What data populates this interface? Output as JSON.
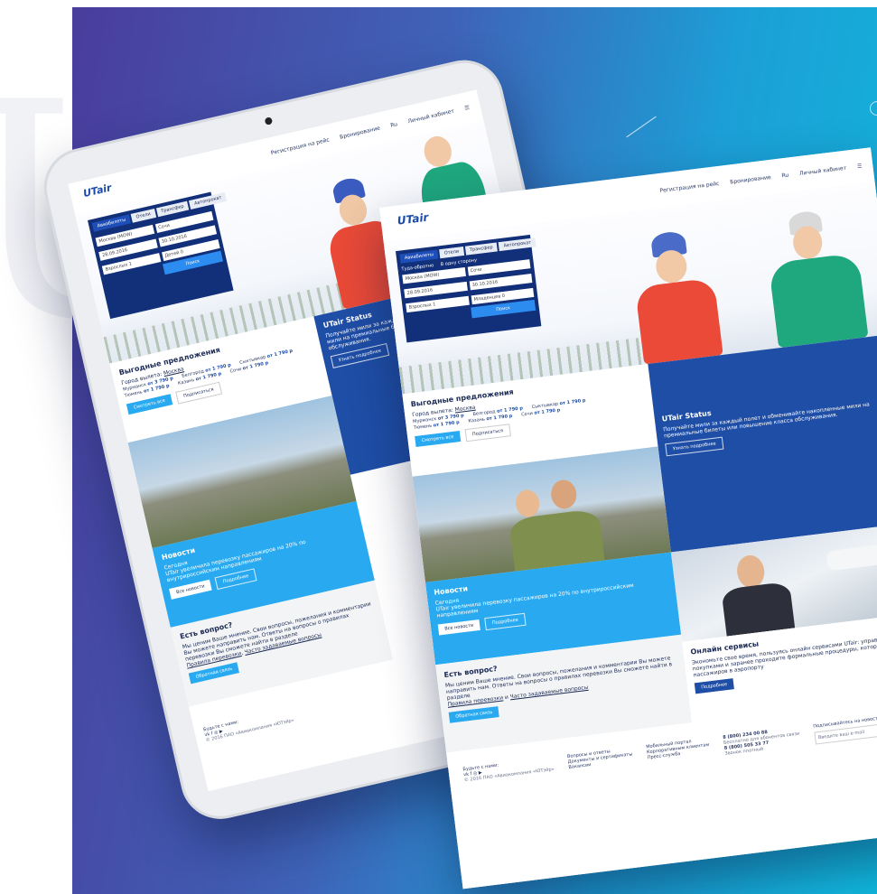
{
  "brand": {
    "logo": "UTair"
  },
  "colors": {
    "navy": "#12307a",
    "blue": "#1f4ea6",
    "light_blue": "#29aaf0"
  },
  "nav": {
    "checkin": "Регистрация на рейс",
    "booking": "Бронирование",
    "lang": "Ru",
    "account": "Личный кабинет",
    "menu_icon": "hamburger-icon"
  },
  "search": {
    "tabs": [
      "Авиабилеты",
      "Отели",
      "Трансфер",
      "Автопрокат"
    ],
    "roundtrip": "Туда-обратно",
    "oneway": "В одну сторону",
    "from": "Москва (MOW)",
    "to": "Сочи",
    "depart": "28.09.2016",
    "return": "30.10.2016",
    "adults": "Взрослых 1",
    "children": "Детей 0",
    "infants": "Младенцев 0",
    "class": "Эконом",
    "search_btn": "Поиск"
  },
  "deals": {
    "title": "Выгодные предложения",
    "from_label": "Город вылета:",
    "from_city": "Москва",
    "items": [
      {
        "city": "Мурманск",
        "price": "от 3 790 р"
      },
      {
        "city": "Белгород",
        "price": "от 1 790 р"
      },
      {
        "city": "Сыктывкар",
        "price": "от 1 790 р"
      },
      {
        "city": "Тюмень",
        "price": "от 1 790 р"
      },
      {
        "city": "Казань",
        "price": "от 1 790 р"
      },
      {
        "city": "Сочи",
        "price": "от 1 790 р"
      }
    ],
    "all_btn": "Смотреть все",
    "sub_btn": "Подписаться"
  },
  "status": {
    "title": "UTair Status",
    "text": "Получайте мили за каждый полет и обменивайте накопленные мили на премиальные билеты или повышение класса обслуживания.",
    "btn": "Узнать подробнее"
  },
  "news": {
    "title": "Новости",
    "date": "Сегодня",
    "text": "UTair увеличила перевозку пассажиров на 20% по внутрироссийским направлениям",
    "all_btn": "Все новости",
    "more_btn": "Подробнее"
  },
  "question": {
    "title": "Есть вопрос?",
    "text": "Мы ценим Ваше мнение. Свои вопросы, пожелания и комментарии Вы можете направить нам. Ответы на вопросы о правилах перевозки Вы сможете найти в разделе",
    "link1": "Правила перевозки",
    "link2": "Часто задаваемые вопросы",
    "btn": "Обратная связь"
  },
  "online": {
    "title": "Онлайн сервисы",
    "text": "Экономьте свое время, пользуясь онлайн сервисами UTair: управляйте своими покупками и заранее проходите формальные процедуры, которые ждут пассажиров в аэропорту",
    "btn": "Подробнее"
  },
  "footer": {
    "social_label": "Будьте с нами:",
    "copyright": "© 2016 ПАО «Авиакомпания «ЮТэйр»",
    "links1": [
      "Вопросы и ответы",
      "Документы и сертификаты",
      "Вакансии"
    ],
    "links2": [
      "Мобильный портал",
      "Корпоративным клиентам",
      "Пресс-служба"
    ],
    "phone1": "8 (800) 234 00 88",
    "phone1_note": "Бесплатно для абонентов связи",
    "phone2": "8 (800) 505 33 77",
    "phone2_note": "Звонок платный",
    "subscribe_label": "Подписывайтесь на новости",
    "email_placeholder": "Введите ваш e-mail"
  }
}
